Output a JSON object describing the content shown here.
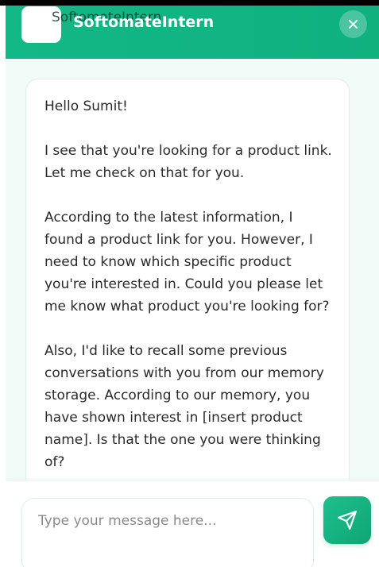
{
  "header": {
    "logo_text": "SoftomateIntern",
    "title": "SoftomateIntern",
    "close_icon": "close-icon"
  },
  "messages": [
    {
      "sender": "bot",
      "paragraphs": [
        "Hello Sumit!",
        "I see that you're looking for a product link. Let me check on that for you.",
        "According to the latest information, I found a product link for you. However, I need to know which specific product you're interested in. Could you please let me know what product you're looking for?",
        "Also, I'd like to recall some previous conversations with you from our memory storage. According to our memory, you have shown interest in [insert product name]. Is that the one you were thinking of?"
      ]
    }
  ],
  "composer": {
    "placeholder": "Type your message here...",
    "send_icon": "send-icon"
  },
  "colors": {
    "accent": "#12b886",
    "panel_bg": "#f3fbf8",
    "bubble_border": "#d8f1e8"
  }
}
